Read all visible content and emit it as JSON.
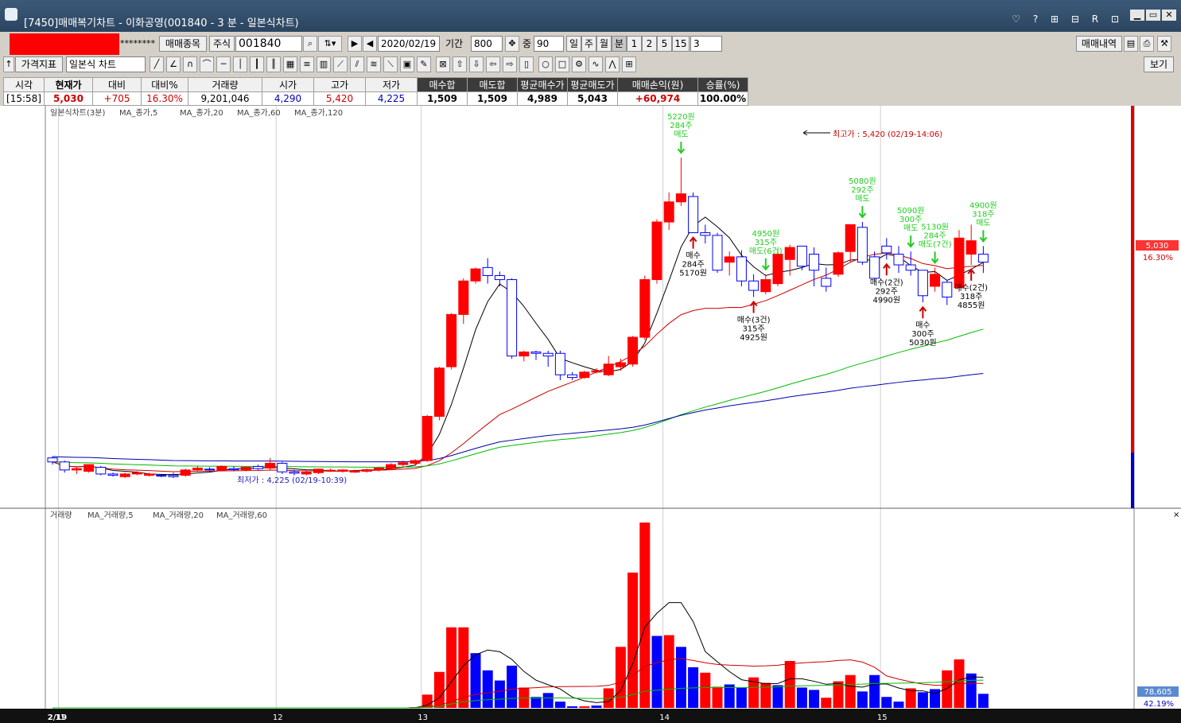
{
  "window": {
    "title": "[7450]매매복기차트 - 이화공영(001840 - 3 분 - 일본식차트)"
  },
  "toolbar1": {
    "account_masked": "********",
    "trade_list_button": "매매종목",
    "market_label": "주식",
    "code": "001840",
    "date": "2020/02/19",
    "period_label": "기간",
    "period_value": "800",
    "overlap_label": "중",
    "overlap_value": "90",
    "periods": [
      "일",
      "주",
      "월",
      "분",
      "1",
      "2",
      "5",
      "15"
    ],
    "minute_select": "3",
    "history_button": "매매내역"
  },
  "toolbar2": {
    "indicator_button": "가격지표",
    "chart_type": "일본식 차트",
    "view_button": "보기"
  },
  "info": {
    "headers": [
      "시각",
      "현재가",
      "대비",
      "대비%",
      "거래량",
      "시가",
      "고가",
      "저가",
      "매수합",
      "매도합",
      "평균매수가",
      "평균매도가",
      "매매손익(원)",
      "승률(%)"
    ],
    "values": [
      "[15:58]",
      "5,030",
      "+705",
      "16.30%",
      "9,201,046",
      "4,290",
      "5,420",
      "4,225",
      "1,509",
      "1,509",
      "4,989",
      "5,043",
      "+60,974",
      "100.00%"
    ]
  },
  "colors": {
    "up": "#ff0000",
    "down": "#0000ff",
    "ma5": "#000000",
    "ma20": "#cc0000",
    "ma60": "#00bb00",
    "ma120": "#0000aa"
  },
  "price_panel": {
    "legend_title": "일본식차트(3분)",
    "legend_items": [
      "MA_종가,5",
      "MA_종가,20",
      "MA_종가,60",
      "MA_종가,120"
    ],
    "high_note": "최고가 : 5,420 (02/19-14:06)",
    "low_note": "최저가 : 4,225 (02/19-10:39)",
    "current_price": "5,030",
    "current_pct": "16.30%",
    "signals": [
      {
        "type": "sell",
        "lines": [
          "5220원",
          "284주",
          "매도"
        ]
      },
      {
        "type": "buy",
        "lines": [
          "매수",
          "284주",
          "5170원"
        ]
      },
      {
        "type": "sell",
        "lines": [
          "4950원",
          "315주",
          "매도(6건)"
        ]
      },
      {
        "type": "buy",
        "lines": [
          "매수(3건)",
          "315주",
          "4925원"
        ]
      },
      {
        "type": "sell",
        "lines": [
          "5080원",
          "292주",
          "매도"
        ]
      },
      {
        "type": "buy",
        "lines": [
          "매수(2건)",
          "292주",
          "4990원"
        ]
      },
      {
        "type": "sell",
        "lines": [
          "5090원",
          "300주",
          "매도"
        ]
      },
      {
        "type": "sell",
        "lines": [
          "5130원",
          "284주",
          "매도(7건)"
        ]
      },
      {
        "type": "buy",
        "lines": [
          "매수",
          "300주",
          "5030원"
        ]
      },
      {
        "type": "sell",
        "lines": [
          "4900원",
          "318주",
          "매도"
        ]
      },
      {
        "type": "buy",
        "lines": [
          "매수(2건)",
          "318주",
          "4855원"
        ]
      }
    ]
  },
  "volume_panel": {
    "legend_title": "거래량",
    "legend_items": [
      "MA_거래량,5",
      "MA_거래량,20",
      "MA_거래량,60"
    ],
    "current_volume": "78,605",
    "current_pct": "42.19%"
  },
  "x_axis": {
    "labels": [
      "2/19",
      "11",
      "12",
      "13",
      "14",
      "15"
    ]
  },
  "chart_data": {
    "type": "candlestick",
    "title": "일본식차트(3분)",
    "y_range": [
      4130,
      5560
    ],
    "volume_range": [
      0,
      240000
    ],
    "series": [
      {
        "name": "MA_종가,5",
        "color": "#000000"
      },
      {
        "name": "MA_종가,20",
        "color": "#cc0000"
      },
      {
        "name": "MA_종가,60",
        "color": "#00bb00"
      },
      {
        "name": "MA_종가,120",
        "color": "#0000aa"
      }
    ],
    "candles": [
      [
        4300,
        4305,
        4275,
        4285
      ],
      [
        4285,
        4290,
        4245,
        4255
      ],
      [
        4255,
        4265,
        4240,
        4260
      ],
      [
        4250,
        4275,
        4245,
        4275
      ],
      [
        4265,
        4270,
        4235,
        4240
      ],
      [
        4240,
        4245,
        4230,
        4235
      ],
      [
        4230,
        4245,
        4225,
        4240
      ],
      [
        4240,
        4250,
        4235,
        4245
      ],
      [
        4235,
        4245,
        4230,
        4240
      ],
      [
        4235,
        4240,
        4228,
        4232
      ],
      [
        4235,
        4245,
        4225,
        4230
      ],
      [
        4235,
        4260,
        4230,
        4255
      ],
      [
        4255,
        4270,
        4250,
        4262
      ],
      [
        4258,
        4265,
        4250,
        4255
      ],
      [
        4255,
        4272,
        4250,
        4268
      ],
      [
        4260,
        4268,
        4250,
        4256
      ],
      [
        4256,
        4268,
        4250,
        4265
      ],
      [
        4268,
        4275,
        4255,
        4260
      ],
      [
        4262,
        4300,
        4255,
        4280
      ],
      [
        4280,
        4285,
        4240,
        4248
      ],
      [
        4248,
        4255,
        4235,
        4243
      ],
      [
        4240,
        4250,
        4235,
        4247
      ],
      [
        4245,
        4260,
        4240,
        4258
      ],
      [
        4252,
        4260,
        4248,
        4254
      ],
      [
        4250,
        4258,
        4245,
        4255
      ],
      [
        4248,
        4256,
        4244,
        4250
      ],
      [
        4250,
        4260,
        4245,
        4256
      ],
      [
        4255,
        4265,
        4250,
        4262
      ],
      [
        4260,
        4280,
        4255,
        4275
      ],
      [
        4275,
        4290,
        4265,
        4282
      ],
      [
        4280,
        4295,
        4270,
        4290
      ],
      [
        4290,
        4460,
        4285,
        4455
      ],
      [
        4455,
        4640,
        4440,
        4635
      ],
      [
        4640,
        4840,
        4630,
        4835
      ],
      [
        4835,
        4970,
        4800,
        4960
      ],
      [
        4960,
        5010,
        4950,
        5005
      ],
      [
        5010,
        5045,
        4950,
        4980
      ],
      [
        4980,
        4995,
        4940,
        4965
      ],
      [
        4965,
        4970,
        4670,
        4680
      ],
      [
        4680,
        4700,
        4660,
        4695
      ],
      [
        4695,
        4700,
        4665,
        4690
      ],
      [
        4690,
        4700,
        4640,
        4680
      ],
      [
        4690,
        4700,
        4590,
        4610
      ],
      [
        4610,
        4620,
        4590,
        4600
      ],
      [
        4600,
        4625,
        4595,
        4620
      ],
      [
        4620,
        4635,
        4615,
        4625
      ],
      [
        4610,
        4680,
        4605,
        4650
      ],
      [
        4640,
        4670,
        4625,
        4655
      ],
      [
        4650,
        4755,
        4640,
        4750
      ],
      [
        4750,
        4980,
        4740,
        4965
      ],
      [
        4965,
        5190,
        4950,
        5180
      ],
      [
        5180,
        5290,
        5150,
        5255
      ],
      [
        5255,
        5420,
        5240,
        5285
      ],
      [
        5275,
        5290,
        5140,
        5140
      ],
      [
        5140,
        5170,
        5100,
        5130
      ],
      [
        5130,
        5140,
        4990,
        5000
      ],
      [
        5030,
        5070,
        4980,
        5050
      ],
      [
        5050,
        5075,
        4940,
        4960
      ],
      [
        4960,
        4985,
        4900,
        4925
      ],
      [
        4920,
        4985,
        4910,
        4965
      ],
      [
        4950,
        5080,
        4940,
        5060
      ],
      [
        5040,
        5095,
        4980,
        5085
      ],
      [
        5090,
        5090,
        5000,
        5015
      ],
      [
        5060,
        5085,
        4940,
        5000
      ],
      [
        4970,
        5010,
        4920,
        4940
      ],
      [
        4985,
        5070,
        4975,
        5065
      ],
      [
        5070,
        5170,
        5030,
        5170
      ],
      [
        5160,
        5180,
        5020,
        5030
      ],
      [
        5050,
        5070,
        4960,
        4970
      ],
      [
        5090,
        5120,
        5040,
        5065
      ],
      [
        5060,
        5090,
        4990,
        5020
      ],
      [
        5020,
        5070,
        4980,
        5000
      ],
      [
        5000,
        5000,
        4880,
        4905
      ],
      [
        4940,
        5010,
        4920,
        4985
      ],
      [
        4955,
        4965,
        4870,
        4900
      ],
      [
        4935,
        5150,
        4920,
        5120
      ],
      [
        5060,
        5170,
        5020,
        5110
      ],
      [
        5060,
        5090,
        4990,
        5030
      ]
    ],
    "volumes": [
      [
        0,
        "u"
      ],
      [
        0,
        "d"
      ],
      [
        0,
        "d"
      ],
      [
        0,
        "u"
      ],
      [
        0,
        "d"
      ],
      [
        0,
        "d"
      ],
      [
        0,
        "u"
      ],
      [
        0,
        "u"
      ],
      [
        0,
        "d"
      ],
      [
        0,
        "d"
      ],
      [
        0,
        "d"
      ],
      [
        0,
        "u"
      ],
      [
        0,
        "u"
      ],
      [
        0,
        "d"
      ],
      [
        0,
        "u"
      ],
      [
        0,
        "d"
      ],
      [
        0,
        "u"
      ],
      [
        0,
        "d"
      ],
      [
        0,
        "u"
      ],
      [
        0,
        "d"
      ],
      [
        0,
        "d"
      ],
      [
        0,
        "u"
      ],
      [
        0,
        "u"
      ],
      [
        0,
        "d"
      ],
      [
        0,
        "u"
      ],
      [
        0,
        "d"
      ],
      [
        0,
        "u"
      ],
      [
        0,
        "u"
      ],
      [
        0,
        "u"
      ],
      [
        0,
        "u"
      ],
      [
        1000,
        "u"
      ],
      [
        17000,
        "u"
      ],
      [
        46000,
        "u"
      ],
      [
        103000,
        "u"
      ],
      [
        103000,
        "u"
      ],
      [
        70000,
        "d"
      ],
      [
        48000,
        "d"
      ],
      [
        35000,
        "d"
      ],
      [
        54000,
        "d"
      ],
      [
        26000,
        "u"
      ],
      [
        14000,
        "d"
      ],
      [
        19000,
        "d"
      ],
      [
        8000,
        "d"
      ],
      [
        2000,
        "d"
      ],
      [
        2000,
        "u"
      ],
      [
        3000,
        "d"
      ],
      [
        25000,
        "u"
      ],
      [
        78000,
        "u"
      ],
      [
        173000,
        "u"
      ],
      [
        237000,
        "u"
      ],
      [
        92000,
        "d"
      ],
      [
        93000,
        "u"
      ],
      [
        78000,
        "d"
      ],
      [
        52000,
        "d"
      ],
      [
        45000,
        "u"
      ],
      [
        27000,
        "u"
      ],
      [
        30000,
        "d"
      ],
      [
        26000,
        "d"
      ],
      [
        39000,
        "u"
      ],
      [
        32000,
        "u"
      ],
      [
        29000,
        "d"
      ],
      [
        60000,
        "u"
      ],
      [
        26000,
        "d"
      ],
      [
        23000,
        "d"
      ],
      [
        13000,
        "u"
      ],
      [
        34000,
        "u"
      ],
      [
        42000,
        "u"
      ],
      [
        21000,
        "d"
      ],
      [
        42000,
        "d"
      ],
      [
        14000,
        "d"
      ],
      [
        8000,
        "d"
      ],
      [
        25000,
        "u"
      ],
      [
        20000,
        "d"
      ],
      [
        24000,
        "d"
      ],
      [
        48000,
        "u"
      ],
      [
        62000,
        "u"
      ],
      [
        44000,
        "d"
      ],
      [
        18000,
        "d"
      ]
    ],
    "day_start_indices": [
      1,
      19,
      31,
      51,
      69
    ]
  }
}
